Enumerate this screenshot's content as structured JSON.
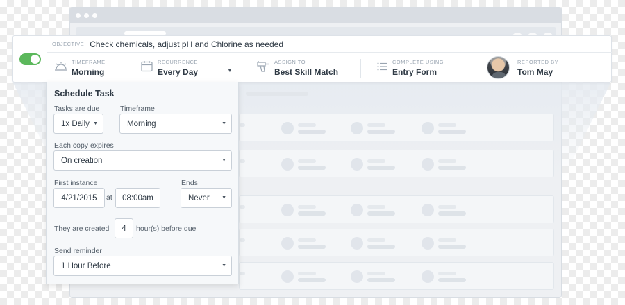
{
  "header": {
    "objective_label": "OBJECTIVE",
    "objective_text": "Check chemicals, adjust pH and Chlorine as needed",
    "toggle_state": "on"
  },
  "fields": {
    "timeframe": {
      "label": "TIMEFRAME",
      "value": "Morning",
      "icon": "sunrise-icon"
    },
    "recurrence": {
      "label": "RECURRENCE",
      "value": "Every Day",
      "icon": "calendar-icon"
    },
    "assign_to": {
      "label": "ASSIGN TO",
      "value": "Best Skill Match",
      "icon": "drill-icon"
    },
    "complete_using": {
      "label": "COMPLETE USING",
      "value": "Entry Form",
      "icon": "list-icon"
    },
    "reported_by": {
      "label": "REPORTED BY",
      "value": "Tom May",
      "icon": "avatar"
    }
  },
  "schedule": {
    "title": "Schedule Task",
    "tasks_due_label": "Tasks are due",
    "tasks_due_value": "1x Daily",
    "timeframe_label": "Timeframe",
    "timeframe_value": "Morning",
    "expires_label": "Each copy expires",
    "expires_value": "On creation",
    "first_instance_label": "First instance",
    "first_instance_date": "4/21/2015",
    "at_label": "at",
    "first_instance_time": "08:00am",
    "ends_label": "Ends",
    "ends_value": "Never",
    "created_label": "They are created",
    "created_hours": "4",
    "created_suffix": "hour(s) before due",
    "reminder_label": "Send reminder",
    "reminder_value": "1 Hour Before"
  },
  "colors": {
    "toggle": "#5cb85c",
    "text": "#2f3a45",
    "muted": "#9aa5b1"
  }
}
